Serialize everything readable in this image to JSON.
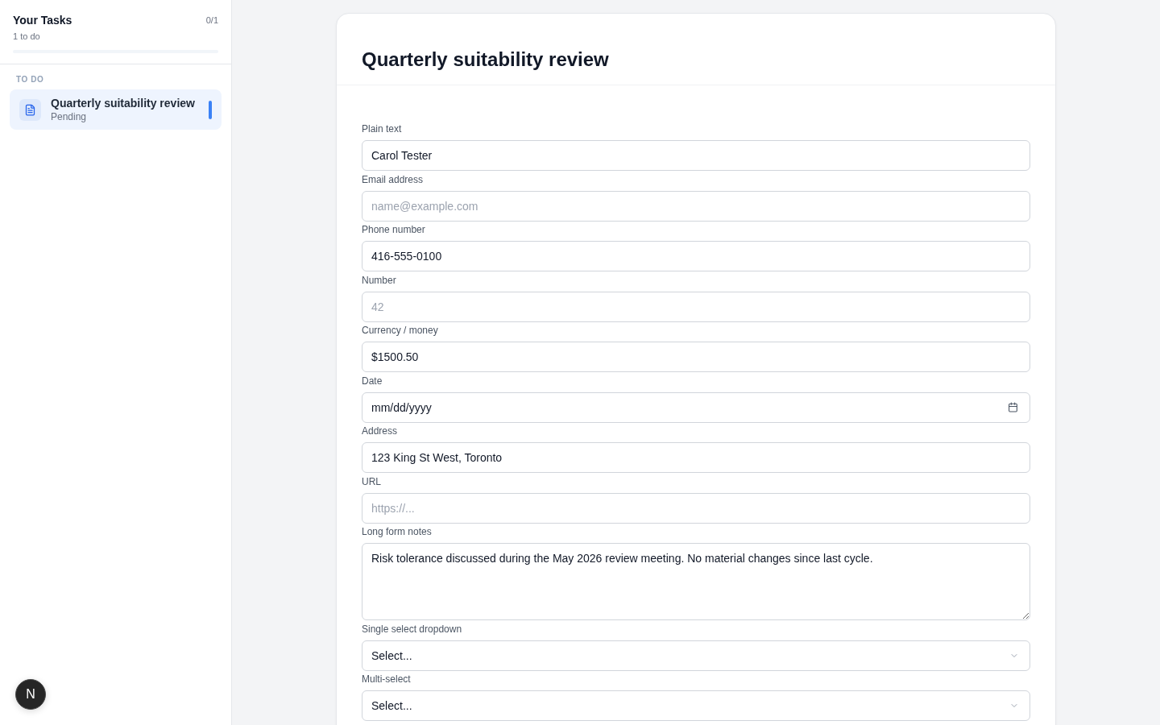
{
  "sidebar": {
    "title": "Your Tasks",
    "count": "0/1",
    "subtitle": "1 to do",
    "progress": {
      "level": 0
    },
    "section_label": "TO DO",
    "tasks": [
      {
        "title": "Quarterly suitability review",
        "status": "Pending",
        "selected": true
      }
    ]
  },
  "form": {
    "title": "Quarterly suitability review",
    "fields": [
      {
        "kind": "text",
        "label": "Plain text",
        "value": "Carol Tester"
      },
      {
        "kind": "text",
        "label": "Email address",
        "placeholder": "name@example.com"
      },
      {
        "kind": "text",
        "label": "Phone number",
        "value": "416-555-0100"
      },
      {
        "kind": "text",
        "label": "Number",
        "placeholder": "42"
      },
      {
        "kind": "text",
        "label": "Currency / money",
        "value": "$1500.50"
      },
      {
        "kind": "date",
        "label": "Date",
        "placeholder": "mm/dd/yyyy"
      },
      {
        "kind": "text",
        "label": "Address",
        "value": "123 King St West, Toronto"
      },
      {
        "kind": "text",
        "label": "URL",
        "placeholder": "https://..."
      },
      {
        "kind": "textarea",
        "label": "Long form notes",
        "value": "Risk tolerance discussed during the May 2026 review meeting. No material changes since last cycle."
      },
      {
        "kind": "select",
        "label": "Single select dropdown",
        "placeholder": "Select..."
      },
      {
        "kind": "select",
        "label": "Multi-select",
        "placeholder": "Select..."
      }
    ]
  },
  "dev_badge": {
    "label": "N"
  }
}
